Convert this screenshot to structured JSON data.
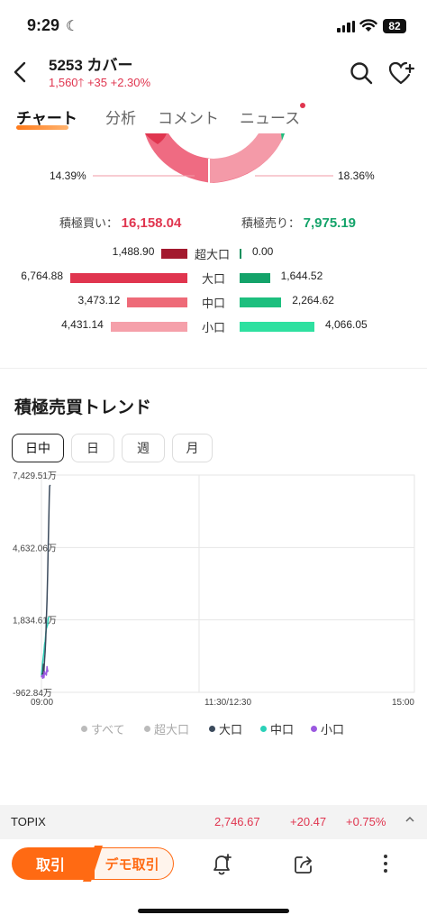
{
  "status": {
    "time": "9:29",
    "battery": "82"
  },
  "header": {
    "code_name": "5253 カバー",
    "price": "1,560",
    "change": "+35",
    "change_pct": "+2.30%"
  },
  "tabs": [
    "チャート",
    "分析",
    "コメント",
    "ニュース"
  ],
  "donut": {
    "left_pct": "14.39%",
    "right_pct": "18.36%"
  },
  "summary": {
    "buy_label": "積極買い：",
    "buy_value": "16,158.04",
    "sell_label": "積極売り：",
    "sell_value": "7,975.19"
  },
  "flows": [
    {
      "label": "超大口",
      "buy": "1,488.90",
      "buy_num": 1488.9,
      "sell": "0.00",
      "sell_num": 0.0,
      "buy_color": "#a3192e",
      "sell_color": "#0e8f5c"
    },
    {
      "label": "大口",
      "buy": "6,764.88",
      "buy_num": 6764.88,
      "sell": "1,644.52",
      "sell_num": 1644.52,
      "buy_color": "#e0354f",
      "sell_color": "#14a36a"
    },
    {
      "label": "中口",
      "buy": "3,473.12",
      "buy_num": 3473.12,
      "sell": "2,264.62",
      "sell_num": 2264.62,
      "buy_color": "#ee6a78",
      "sell_color": "#1dbf7e"
    },
    {
      "label": "小口",
      "buy": "4,431.14",
      "buy_num": 4431.14,
      "sell": "4,066.05",
      "sell_num": 4066.05,
      "buy_color": "#f5a0aa",
      "sell_color": "#2ee0a0"
    }
  ],
  "trend": {
    "title": "積極売買トレンド",
    "periods": [
      "日中",
      "日",
      "週",
      "月"
    ],
    "active_period": 0
  },
  "chart_data": {
    "type": "line",
    "y_tick_labels": [
      "7,429.51万",
      "4,632.06万",
      "1,834.61万",
      "-962.84万"
    ],
    "y_ticks": [
      7429.51,
      4632.06,
      1834.61,
      -962.84
    ],
    "ylim": [
      -962.84,
      7429.51
    ],
    "x_tick_labels": [
      "09:00",
      "11:30/12:30",
      "15:00"
    ],
    "legend": [
      {
        "name": "すべて",
        "color": "#bbbbbb",
        "visible": false
      },
      {
        "name": "超大口",
        "color": "#bbbbbb",
        "visible": false
      },
      {
        "name": "大口",
        "color": "#3b4a5c",
        "visible": true
      },
      {
        "name": "中口",
        "color": "#2ad1b8",
        "visible": true
      },
      {
        "name": "小口",
        "color": "#9b59e0",
        "visible": true
      }
    ],
    "series": [
      {
        "name": "大口",
        "color": "#3b4a5c",
        "points": [
          [
            0,
            -250
          ],
          [
            1,
            -250
          ],
          [
            1.5,
            120
          ],
          [
            2,
            -120
          ],
          [
            2.5,
            300
          ],
          [
            3,
            600
          ],
          [
            3.5,
            1100
          ],
          [
            4,
            1900
          ],
          [
            4.5,
            2600
          ],
          [
            5,
            3600
          ],
          [
            5.5,
            4800
          ],
          [
            6,
            5900
          ],
          [
            6.3,
            6600
          ],
          [
            6.6,
            7000
          ],
          [
            7,
            7050
          ]
        ]
      },
      {
        "name": "中口",
        "color": "#2ad1b8",
        "points": [
          [
            0,
            -300
          ],
          [
            1,
            200
          ],
          [
            1.5,
            420
          ],
          [
            2,
            600
          ],
          [
            2.5,
            900
          ],
          [
            3,
            1000
          ],
          [
            3.5,
            1300
          ],
          [
            4,
            1500
          ],
          [
            5,
            1650
          ],
          [
            5.5,
            1900
          ],
          [
            6.2,
            1950
          ]
        ]
      },
      {
        "name": "小口",
        "color": "#9b59e0",
        "points": [
          [
            0,
            -380
          ],
          [
            0.6,
            -60
          ],
          [
            1,
            -420
          ],
          [
            1.5,
            -120
          ],
          [
            2,
            -400
          ],
          [
            2.5,
            -150
          ],
          [
            3,
            -220
          ],
          [
            4,
            -300
          ],
          [
            4.5,
            30
          ],
          [
            5,
            -160
          ],
          [
            5.4,
            -110
          ]
        ]
      }
    ]
  },
  "topix": {
    "name": "TOPIX",
    "value": "2,746.67",
    "change": "+20.47",
    "change_pct": "+0.75%"
  },
  "bottom": {
    "trade": "取引",
    "demo_trade": "デモ取引"
  }
}
